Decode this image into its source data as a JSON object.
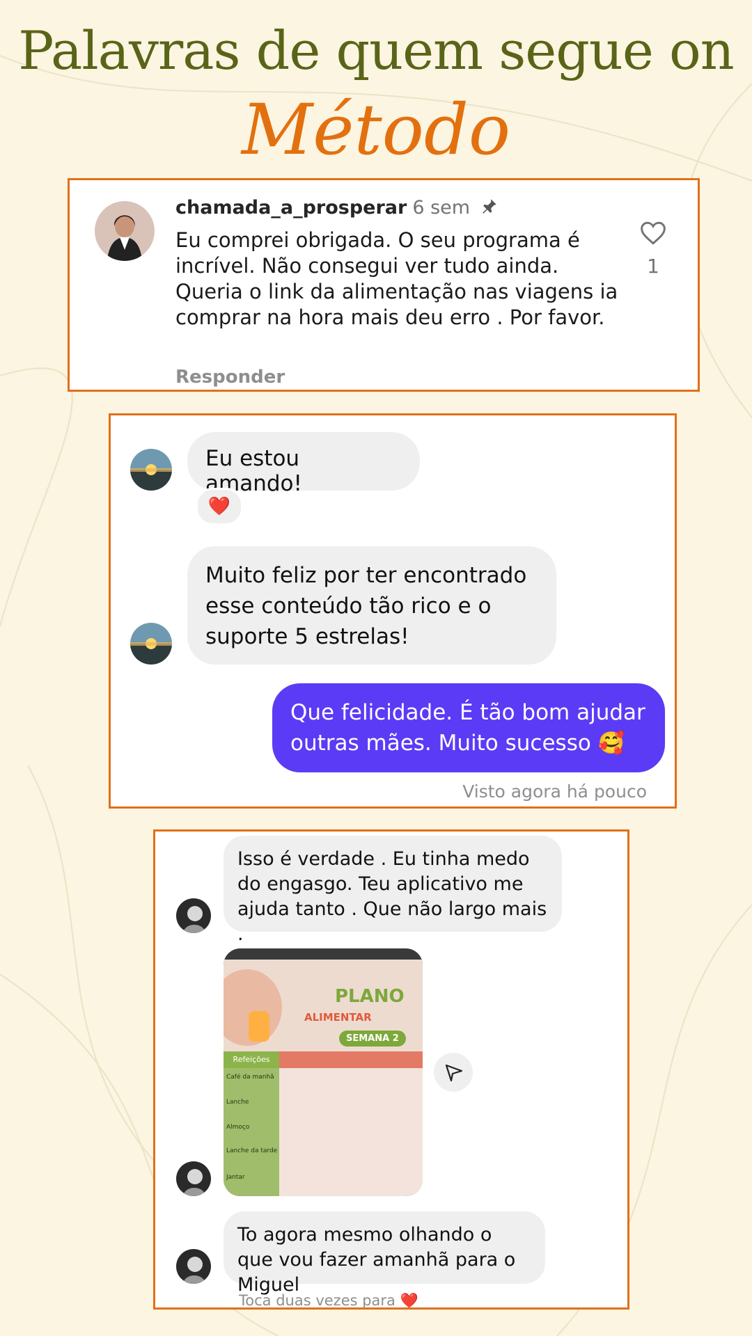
{
  "header": {
    "title": "Palavras de quem segue on",
    "subtitle": "Método"
  },
  "comment_card": {
    "username": "chamada_a_prosperar",
    "time": "6 sem",
    "text": "Eu comprei obrigada.  O seu programa é incrível. Não consegui ver tudo ainda. Queria o link da alimentação nas viagens ia comprar na hora mais deu erro . Por favor.",
    "reply_label": "Responder",
    "like_count": "1",
    "icons": [
      "pin-icon",
      "heart-outline-icon"
    ]
  },
  "chat1": {
    "messages": [
      {
        "from": "them",
        "text": "Eu estou amando!",
        "reaction": "❤️"
      },
      {
        "from": "them",
        "text": "Muito feliz por ter encontrado esse conteúdo tão rico e o suporte 5 estrelas!"
      },
      {
        "from": "me",
        "text": "Que felicidade. É tão bom ajudar outras mães.  Muito sucesso 🥰"
      }
    ],
    "seen_label": "Visto agora há pouco",
    "colors": {
      "my_bubble": "#5b3bf5",
      "their_bubble": "#efefef"
    }
  },
  "chat2": {
    "messages": [
      {
        "from": "them",
        "text": "Isso é verdade . Eu tinha medo do engasgo. Teu aplicativo me ajuda tanto . Que não largo mais ."
      },
      {
        "from": "them",
        "type": "image",
        "photo_text": {
          "title": "PLANO",
          "subtitle": "ALIMENTAR",
          "week": "SEMANA 2",
          "col_header": "Refeições",
          "rows": [
            "Café da manhã",
            "Lanche",
            "Almoço",
            "Lanche da tarde",
            "Jantar"
          ]
        }
      },
      {
        "from": "them",
        "text": "To agora mesmo olhando o que vou fazer amanhã para o Miguel"
      }
    ],
    "hint": "Toca duas vezes para",
    "hint_icon": "❤️"
  },
  "colors": {
    "accent_orange": "#e0701a",
    "title_olive": "#5a6418",
    "background": "#fbf5e1"
  }
}
